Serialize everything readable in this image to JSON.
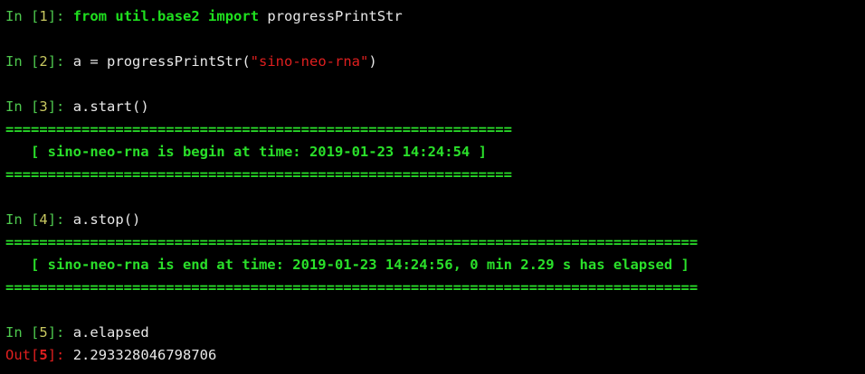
{
  "colors": {
    "background": "#000000",
    "prompt_in": "#4ec94e",
    "prompt_number": "#c8c860",
    "prompt_out": "#e01f1f",
    "keyword": "#1fe01f",
    "string": "#e01f1f",
    "stream_output": "#2ae02a",
    "code_text": "#e8e8e8"
  },
  "cells": [
    {
      "in_label": "In ",
      "open": "[",
      "number": "1",
      "close": "]:",
      "code": {
        "kw_from": "from",
        "module": "util.base2",
        "kw_import": "import",
        "name": "progressPrintStr"
      }
    },
    {
      "in_label": "In ",
      "open": "[",
      "number": "2",
      "close": "]:",
      "code": {
        "before": "a = progressPrintStr(",
        "string": "\"sino-neo-rna\"",
        "after": ")"
      }
    },
    {
      "in_label": "In ",
      "open": "[",
      "number": "3",
      "close": "]:",
      "code": {
        "text": "a.start()"
      },
      "output": {
        "rule": "============================================================",
        "message": "   [ sino-neo-rna is begin at time: 2019-01-23 14:24:54 ]"
      }
    },
    {
      "in_label": "In ",
      "open": "[",
      "number": "4",
      "close": "]:",
      "code": {
        "text": "a.stop()"
      },
      "output": {
        "rule": "==================================================================================",
        "message": "   [ sino-neo-rna is end at time: 2019-01-23 14:24:56, 0 min 2.29 s has elapsed ]"
      }
    },
    {
      "in_label": "In ",
      "open": "[",
      "number": "5",
      "close": "]:",
      "code": {
        "text": "a.elapsed"
      },
      "out": {
        "label": "Out",
        "open": "[",
        "number": "5",
        "close": "]:",
        "value": "2.293328046798706"
      }
    }
  ]
}
